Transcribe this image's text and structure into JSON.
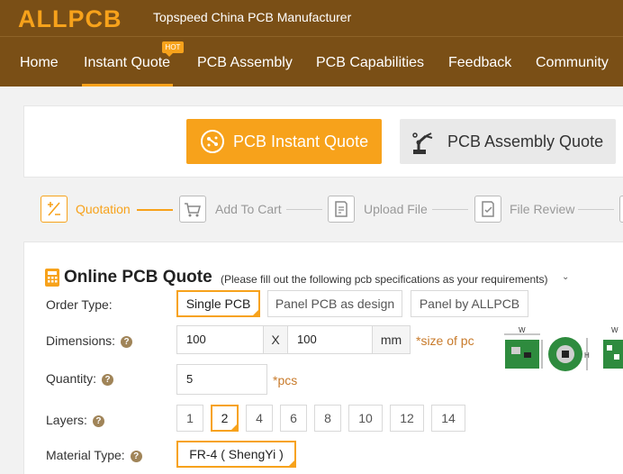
{
  "header": {
    "logo": "ALLPCB",
    "tagline": "Topspeed China PCB Manufacturer",
    "nav": [
      {
        "label": "Home"
      },
      {
        "label": "Instant Quote"
      },
      {
        "label": "PCB Assembly"
      },
      {
        "label": "PCB Capabilities"
      },
      {
        "label": "Feedback"
      },
      {
        "label": "Community"
      }
    ],
    "hot_badge": "HOT",
    "colors": {
      "bar": "#7a4f16",
      "accent": "#f7a21b"
    }
  },
  "quote_types": {
    "instant": "PCB Instant Quote",
    "assembly": "PCB Assembly Quote"
  },
  "steps": [
    {
      "label": "Quotation"
    },
    {
      "label": "Add To Cart"
    },
    {
      "label": "Upload File"
    },
    {
      "label": "File Review"
    }
  ],
  "form": {
    "title": "Online PCB Quote",
    "hint": "(Please fill out the following pcb specifications as your requirements)",
    "order_type": {
      "label": "Order Type:",
      "options": [
        "Single PCB",
        "Panel PCB as design",
        "Panel by ALLPCB"
      ],
      "selected": "Single PCB"
    },
    "dimensions": {
      "label": "Dimensions:",
      "width": "100",
      "separator": "X",
      "height": "100",
      "unit": "mm",
      "note": "*size of pc"
    },
    "quantity": {
      "label": "Quantity:",
      "value": "5",
      "unit": "*pcs"
    },
    "layers": {
      "label": "Layers:",
      "options": [
        "1",
        "2",
        "4",
        "6",
        "8",
        "10",
        "12",
        "14"
      ],
      "selected": "2"
    },
    "material": {
      "label": "Material Type:",
      "value": "FR-4 ( ShengYi )"
    },
    "help_glyph": "?"
  }
}
